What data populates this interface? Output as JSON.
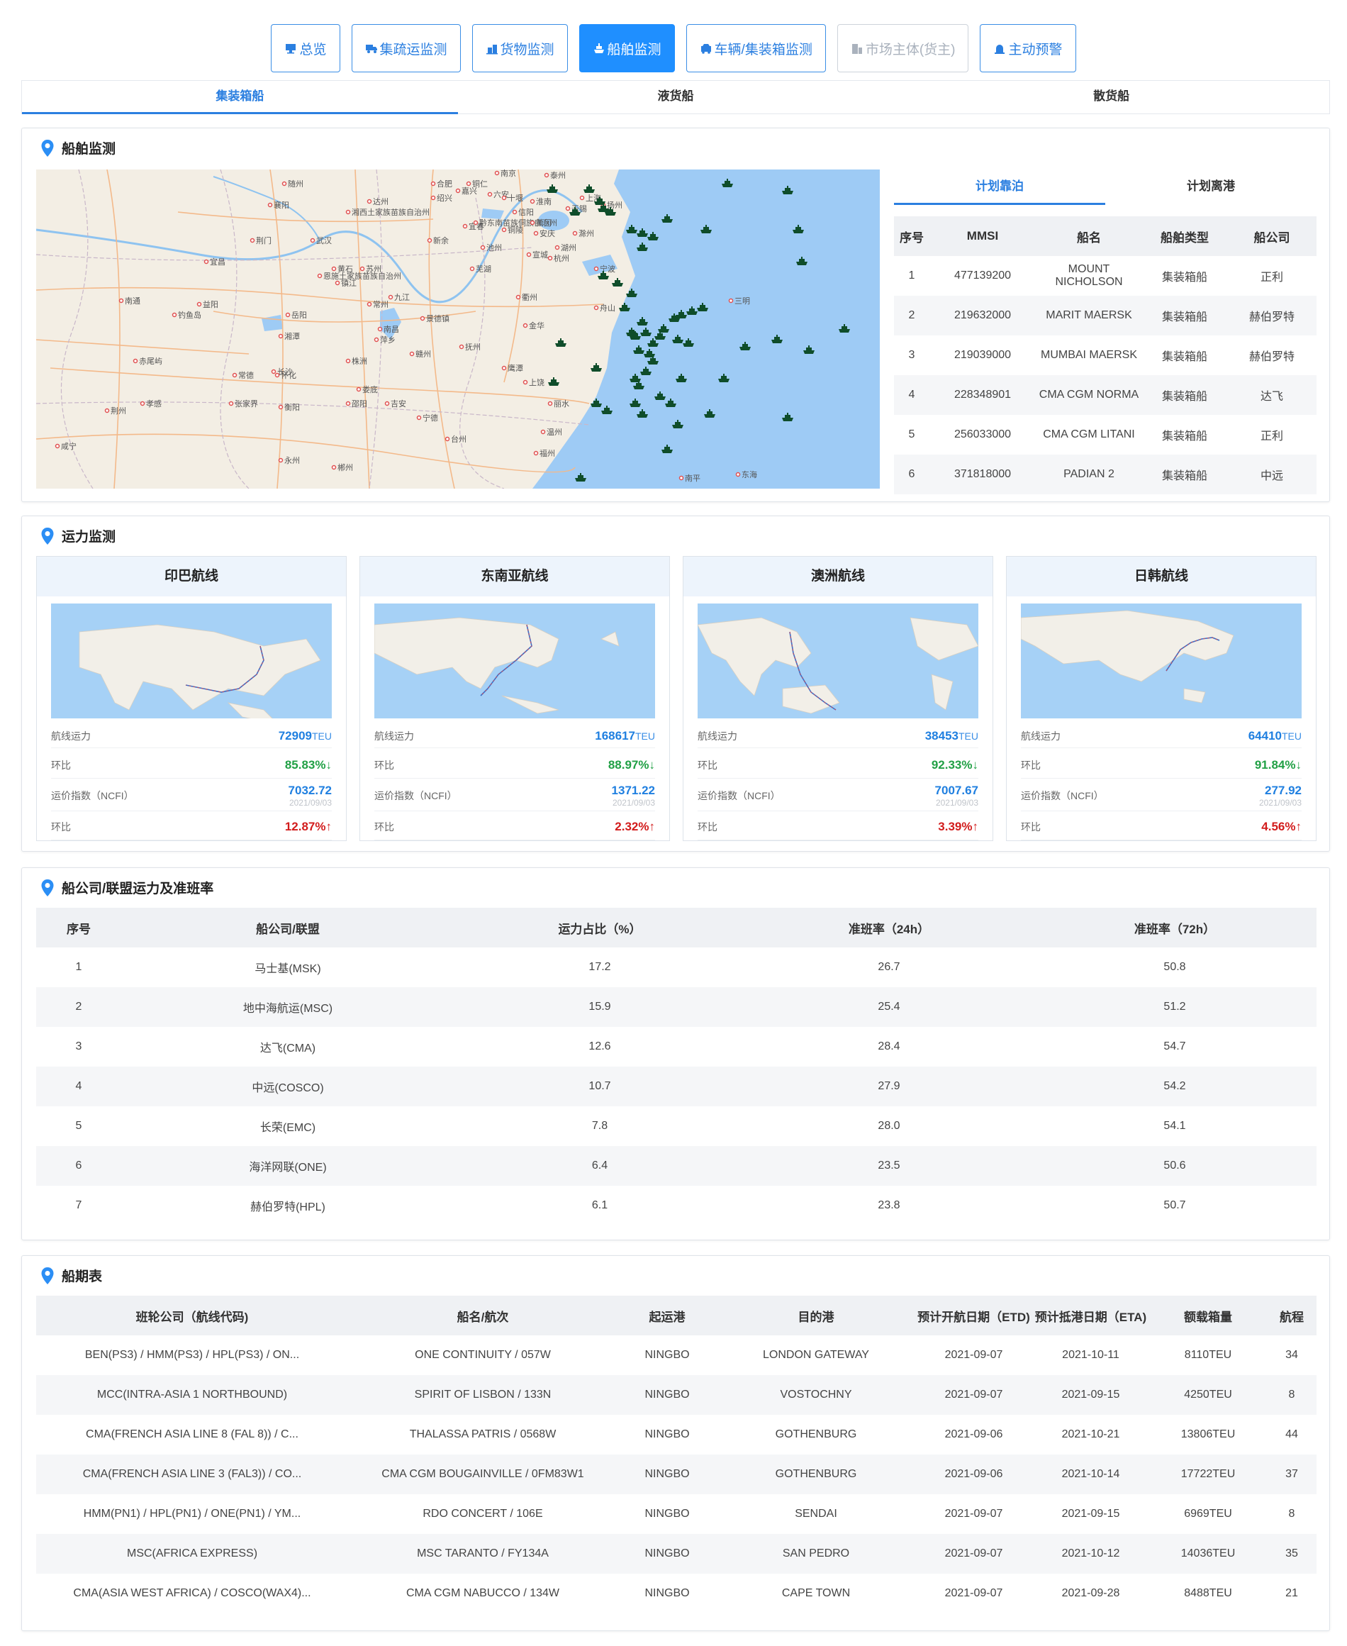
{
  "nav": [
    {
      "label": "总览",
      "icon": "monitor-icon",
      "state": "normal"
    },
    {
      "label": "集疏运监测",
      "icon": "truck-icon",
      "state": "normal"
    },
    {
      "label": "货物监测",
      "icon": "cargo-icon",
      "state": "normal"
    },
    {
      "label": "船舶监测",
      "icon": "ship-icon",
      "state": "active"
    },
    {
      "label": "车辆/集装箱监测",
      "icon": "vehicle-icon",
      "state": "normal"
    },
    {
      "label": "市场主体(货主)",
      "icon": "building-icon",
      "state": "disabled"
    },
    {
      "label": "主动预警",
      "icon": "alarm-icon",
      "state": "normal"
    }
  ],
  "tabs": [
    "集装箱船",
    "液货船",
    "散货船"
  ],
  "ship_monitor": {
    "title": "船舶监测",
    "map_labels": [
      "合肥",
      "南京",
      "泰州",
      "上海",
      "无锡",
      "杭州",
      "宁波",
      "舟山",
      "金华",
      "衢州",
      "温州",
      "福州",
      "武汉",
      "长沙",
      "南昌",
      "九江",
      "黄石",
      "景德镇",
      "襄阳",
      "荆门",
      "随州",
      "宜昌",
      "岳阳",
      "常德",
      "益阳",
      "湘潭",
      "株洲",
      "衡阳",
      "永州",
      "郴州",
      "吉安",
      "赣州",
      "抚州",
      "鹰潭",
      "上饶",
      "丽水",
      "台州",
      "宁德",
      "三明",
      "南平",
      "东海",
      "钓鱼岛",
      "赤尾屿",
      "张家界",
      "怀化",
      "邵阳",
      "娄底",
      "萍乡",
      "宜春",
      "新余",
      "池州",
      "安庆",
      "铜陵",
      "芜湖",
      "宣城",
      "湖州",
      "嘉兴",
      "绍兴",
      "六安",
      "淮南",
      "滁州",
      "扬州",
      "镇江",
      "常州",
      "苏州",
      "南通",
      "孝感",
      "咸宁",
      "荆州",
      "恩施土家族苗族自治州",
      "湘西土家族苗族自治州",
      "黔东南苗族侗族自治州",
      "铜仁",
      "达州",
      "十堰",
      "信阳",
      "黄冈"
    ],
    "subtabs": [
      "计划靠泊",
      "计划离港"
    ],
    "columns": [
      "序号",
      "MMSI",
      "船名",
      "船舶类型",
      "船公司"
    ],
    "rows": [
      [
        "1",
        "477139200",
        "MOUNT NICHOLSON",
        "集装箱船",
        "正利"
      ],
      [
        "2",
        "219632000",
        "MARIT MAERSK",
        "集装箱船",
        "赫伯罗特"
      ],
      [
        "3",
        "219039000",
        "MUMBAI MAERSK",
        "集装箱船",
        "赫伯罗特"
      ],
      [
        "4",
        "228348901",
        "CMA CGM NORMA",
        "集装箱船",
        "达飞"
      ],
      [
        "5",
        "256033000",
        "CMA CGM LITANI",
        "集装箱船",
        "正利"
      ],
      [
        "6",
        "371818000",
        "PADIAN 2",
        "集装箱船",
        "中远"
      ]
    ]
  },
  "capacity": {
    "title": "运力监测",
    "labels": {
      "capacity": "航线运力",
      "mom": "环比",
      "index": "运价指数（NCFI）",
      "unit": "TEU"
    },
    "routes": [
      {
        "name": "印巴航线",
        "capacity": "72909",
        "cap_mom": "85.83%↓",
        "index": "7032.72",
        "date": "2021/09/03",
        "idx_mom": "12.87%↑"
      },
      {
        "name": "东南亚航线",
        "capacity": "168617",
        "cap_mom": "88.97%↓",
        "index": "1371.22",
        "date": "2021/09/03",
        "idx_mom": "2.32%↑"
      },
      {
        "name": "澳洲航线",
        "capacity": "38453",
        "cap_mom": "92.33%↓",
        "index": "7007.67",
        "date": "2021/09/03",
        "idx_mom": "3.39%↑"
      },
      {
        "name": "日韩航线",
        "capacity": "64410",
        "cap_mom": "91.84%↓",
        "index": "277.92",
        "date": "2021/09/03",
        "idx_mom": "4.56%↑"
      }
    ]
  },
  "alliance": {
    "title": "船公司/联盟运力及准班率",
    "columns": [
      "序号",
      "船公司/联盟",
      "运力占比（%）",
      "准班率（24h）",
      "准班率（72h）"
    ],
    "rows": [
      [
        "1",
        "马士基(MSK)",
        "17.2",
        "26.7",
        "50.8"
      ],
      [
        "2",
        "地中海航运(MSC)",
        "15.9",
        "25.4",
        "51.2"
      ],
      [
        "3",
        "达飞(CMA)",
        "12.6",
        "28.4",
        "54.7"
      ],
      [
        "4",
        "中远(COSCO)",
        "10.7",
        "27.9",
        "54.2"
      ],
      [
        "5",
        "长荣(EMC)",
        "7.8",
        "28.0",
        "54.1"
      ],
      [
        "6",
        "海洋网联(ONE)",
        "6.4",
        "23.5",
        "50.6"
      ],
      [
        "7",
        "赫伯罗特(HPL)",
        "6.1",
        "23.8",
        "50.7"
      ]
    ]
  },
  "schedule": {
    "title": "船期表",
    "columns": [
      "班轮公司（航线代码)",
      "船名/航次",
      "起运港",
      "目的港",
      "预计开航日期（ETD)",
      "预计抵港日期（ETA)",
      "额载箱量",
      "航程"
    ],
    "rows": [
      [
        "BEN(PS3) / HMM(PS3) / HPL(PS3) / ON...",
        "ONE CONTINUITY / 057W",
        "NINGBO",
        "LONDON GATEWAY",
        "2021-09-07",
        "2021-10-11",
        "8110TEU",
        "34"
      ],
      [
        "MCC(INTRA-ASIA 1 NORTHBOUND)",
        "SPIRIT OF LISBON / 133N",
        "NINGBO",
        "VOSTOCHNY",
        "2021-09-07",
        "2021-09-15",
        "4250TEU",
        "8"
      ],
      [
        "CMA(FRENCH ASIA LINE 8 (FAL 8)) / C...",
        "THALASSA PATRIS / 0568W",
        "NINGBO",
        "GOTHENBURG",
        "2021-09-06",
        "2021-10-21",
        "13806TEU",
        "44"
      ],
      [
        "CMA(FRENCH ASIA LINE 3 (FAL3)) / CO...",
        "CMA CGM BOUGAINVILLE / 0FM83W1",
        "NINGBO",
        "GOTHENBURG",
        "2021-09-06",
        "2021-10-14",
        "17722TEU",
        "37"
      ],
      [
        "HMM(PN1) / HPL(PN1) / ONE(PN1) / YM...",
        "RDO CONCERT / 106E",
        "NINGBO",
        "SENDAI",
        "2021-09-07",
        "2021-09-15",
        "6969TEU",
        "8"
      ],
      [
        "MSC(AFRICA EXPRESS)",
        "MSC TARANTO / FY134A",
        "NINGBO",
        "SAN PEDRO",
        "2021-09-07",
        "2021-10-12",
        "14036TEU",
        "35"
      ],
      [
        "CMA(ASIA WEST AFRICA) / COSCO(WAX4)...",
        "CMA CGM NABUCCO / 134W",
        "NINGBO",
        "CAPE TOWN",
        "2021-09-07",
        "2021-09-28",
        "8488TEU",
        "21"
      ]
    ]
  }
}
